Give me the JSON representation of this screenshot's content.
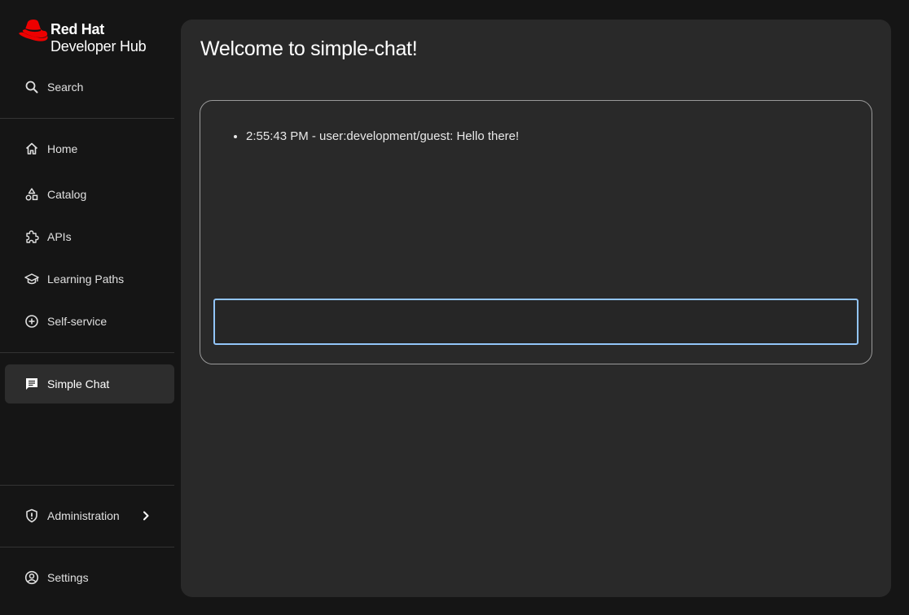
{
  "brand": {
    "name": "Red Hat",
    "product": "Developer Hub",
    "logo_icon": "red-hat-icon",
    "accent": "#ee0000"
  },
  "sidebar": {
    "search": {
      "label": "Search",
      "icon": "search-icon"
    },
    "items": [
      {
        "label": "Home",
        "icon": "home-icon"
      },
      {
        "label": "Catalog",
        "icon": "catalog-shapes-icon"
      },
      {
        "label": "APIs",
        "icon": "puzzle-icon"
      },
      {
        "label": "Learning Paths",
        "icon": "graduation-cap-icon"
      },
      {
        "label": "Self-service",
        "icon": "plus-circle-icon"
      }
    ],
    "plugins": [
      {
        "label": "Simple Chat",
        "icon": "chat-icon",
        "active": true
      }
    ],
    "admin": {
      "label": "Administration",
      "icon": "shield-icon",
      "expand_icon": "chevron-right-icon"
    },
    "settings": {
      "label": "Settings",
      "icon": "user-circle-icon"
    }
  },
  "main": {
    "title": "Welcome to simple-chat!",
    "messages": [
      {
        "text": "2:55:43 PM - user:development/guest: Hello there!"
      }
    ],
    "input": {
      "value": "",
      "placeholder": "",
      "focus_color": "#92c5f9"
    }
  }
}
